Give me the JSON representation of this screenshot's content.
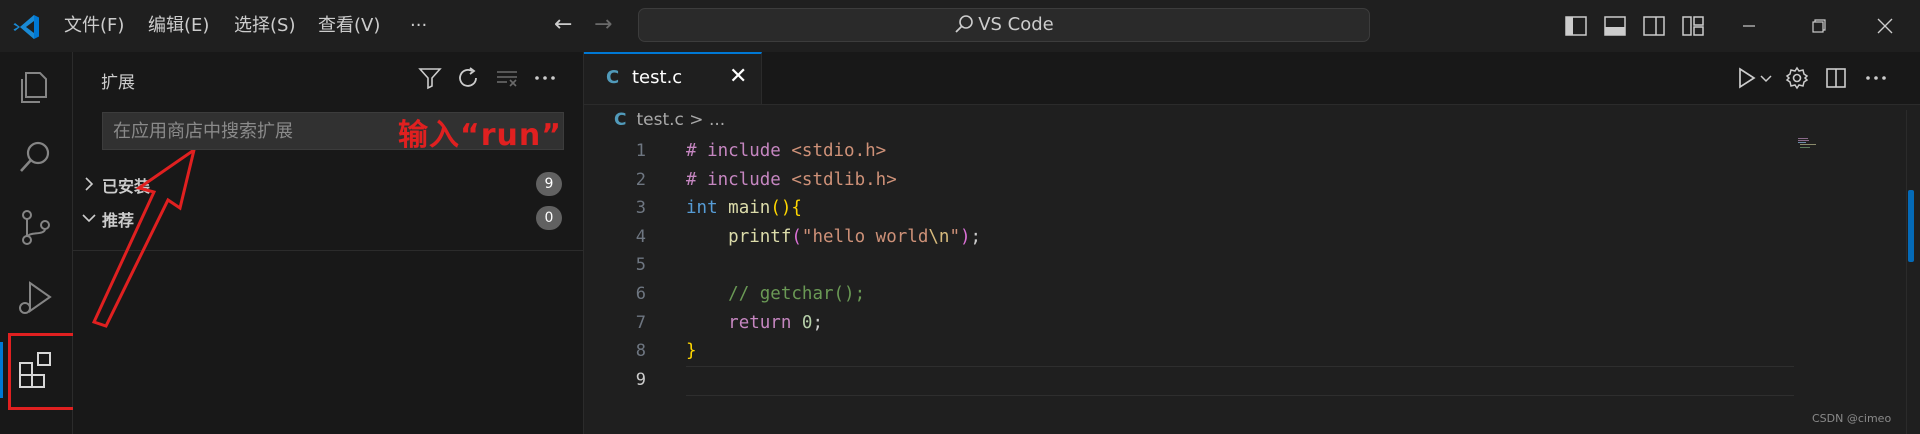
{
  "titlebar": {
    "menu": [
      "文件(F)",
      "编辑(E)",
      "选择(S)",
      "查看(V)"
    ],
    "more": "···",
    "command_center": "VS Code"
  },
  "sidebar": {
    "title": "扩展",
    "search_placeholder": "在应用商店中搜索扩展",
    "annotation": "输入“run”",
    "sections": [
      {
        "label": "已安装",
        "count": "9"
      },
      {
        "label": "推荐",
        "count": "0"
      }
    ]
  },
  "editor": {
    "tab": {
      "icon": "C",
      "name": "test.c"
    },
    "breadcrumb": {
      "icon": "C",
      "file": "test.c",
      "sep": ">",
      "more": "..."
    },
    "line_numbers": [
      "1",
      "2",
      "3",
      "4",
      "5",
      "6",
      "7",
      "8",
      "9"
    ]
  },
  "watermark": "CSDN @cimeo",
  "colors": {
    "accent": "#0078d4",
    "annotation_red": "#e02020",
    "background": "#181818"
  },
  "icons": [
    "vscode-logo-icon",
    "explorer-icon",
    "search-icon",
    "source-control-icon",
    "run-debug-icon",
    "extensions-icon",
    "filter-icon",
    "refresh-icon",
    "clear-icon",
    "more-icon",
    "run-icon",
    "settings-icon",
    "split-editor-icon"
  ]
}
